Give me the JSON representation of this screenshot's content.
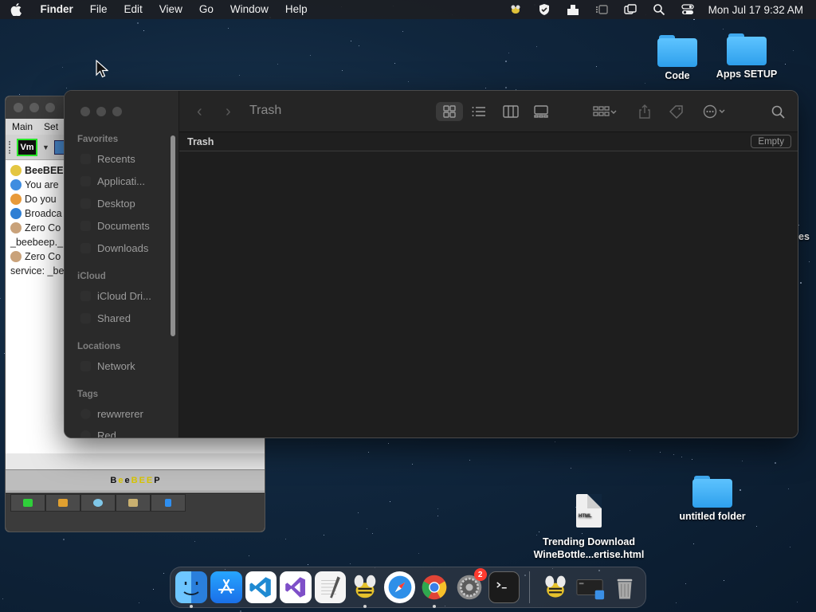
{
  "menubar": {
    "app_name": "Finder",
    "items": [
      "File",
      "Edit",
      "View",
      "Go",
      "Window",
      "Help"
    ],
    "clock": "Mon Jul 17  9:32 AM"
  },
  "desktop": {
    "icons": [
      {
        "label": "Code"
      },
      {
        "label": "Apps SETUP"
      },
      {
        "label": "untitled folder"
      }
    ],
    "file": {
      "line1": "Trending Download",
      "line2": "WineBottle...ertise.html",
      "tag": "HTML"
    },
    "partial_label": "es"
  },
  "beebeep": {
    "menu": [
      "Main",
      "Set"
    ],
    "vm_label": "Vm",
    "log": [
      "BeeBEE",
      "You are",
      "Do you",
      "Broadca",
      "Zero Co",
      "_beebeep._",
      "Zero Co",
      "service: _be"
    ],
    "brand": [
      "B",
      "e",
      "e",
      "B",
      "E",
      "E",
      "P"
    ],
    "brand_colors": [
      "#111111",
      "#d7c400",
      "#111111",
      "#d7c400",
      "#d7c400",
      "#d7c400",
      "#111111"
    ]
  },
  "finder": {
    "title": "Trash",
    "path_label": "Trash",
    "empty_button": "Empty",
    "sidebar": {
      "favorites_label": "Favorites",
      "favorites": [
        "Recents",
        "Applicati...",
        "Desktop",
        "Documents",
        "Downloads"
      ],
      "icloud_label": "iCloud",
      "icloud": [
        "iCloud Dri...",
        "Shared"
      ],
      "locations_label": "Locations",
      "locations": [
        "Network"
      ],
      "tags_label": "Tags",
      "tags": [
        "rewwrerer",
        "Red"
      ]
    }
  },
  "dock": {
    "apps": [
      {
        "name": "finder-icon",
        "color": "#3a8fe6"
      },
      {
        "name": "app-store-icon",
        "color": "#1e8cf0"
      },
      {
        "name": "vscode-icon",
        "color": "#1f6fc4"
      },
      {
        "name": "visual-studio-icon",
        "color": "#6b3fbf"
      },
      {
        "name": "textedit-icon",
        "color": "#e9e9e9"
      },
      {
        "name": "beebeep-icon",
        "color": "#d8b21c"
      },
      {
        "name": "safari-icon",
        "color": "#2a8ce8"
      },
      {
        "name": "chrome-icon",
        "color": "#e04436"
      },
      {
        "name": "system-settings-icon",
        "color": "#7d7d7d"
      },
      {
        "name": "terminal-icon",
        "color": "#1a1a1a"
      }
    ],
    "settings_badge": "2"
  }
}
